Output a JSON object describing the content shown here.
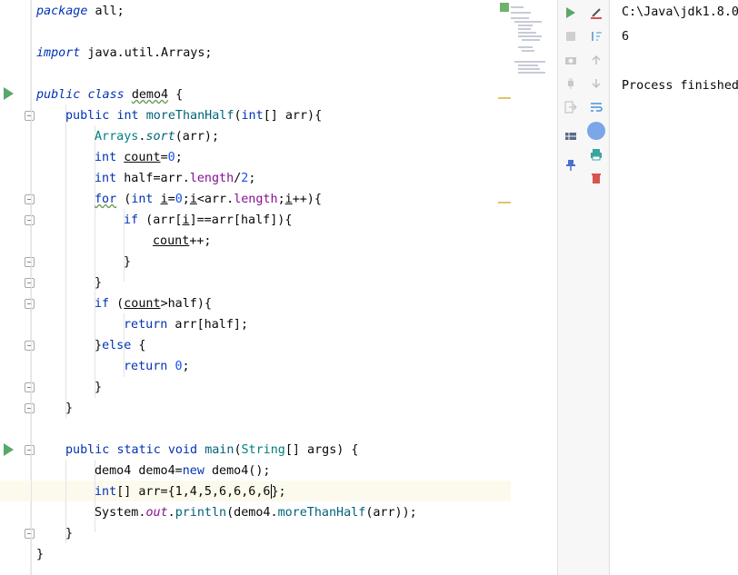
{
  "editor": {
    "lines": {
      "l1": {
        "kw": "package",
        "rest": " all;"
      },
      "l3": {
        "kw": "import",
        "rest": " java.util.Arrays;"
      },
      "l5": {
        "kw1": "public",
        "kw2": "class",
        "name": "demo4",
        "rest": " {"
      },
      "l6": {
        "kw1": "public",
        "type": "int",
        "fn": "moreThanHalf",
        "args_a": "(",
        "type2": "int",
        "args_b": "[] arr){"
      },
      "l7": {
        "cls": "Arrays",
        "dot": ".",
        "fn": "sort",
        "rest": "(arr);"
      },
      "l8": {
        "type": "int",
        "var": "count",
        "eq": "=",
        "num": "0",
        "semi": ";"
      },
      "l9": {
        "type": "int",
        "rest": " half=arr.",
        "fld": "length",
        "op": "/",
        "num": "2",
        "semi": ";"
      },
      "l10": {
        "kw": "for",
        "p1": " (",
        "type": "int",
        "var": "i",
        "eq": "=",
        "num": "0",
        "sc": ";",
        "var2": "i",
        "lt": "<arr.",
        "fld": "length",
        "sc2": ";",
        "var3": "i",
        "inc": "++){"
      },
      "l11": {
        "kw": "if",
        "p1": " (arr[",
        "var": "i",
        "p2": "]==arr[half]){"
      },
      "l12": {
        "var": "count",
        "inc": "++;"
      },
      "l13": {
        "text": "}"
      },
      "l14": {
        "text": "}"
      },
      "l15": {
        "kw": "if",
        "p1": " (",
        "var": "count",
        "rest": ">half){"
      },
      "l16": {
        "kw": "return",
        "rest": " arr[half];"
      },
      "l17": {
        "a": "}",
        "kw": "else",
        "b": " {"
      },
      "l18": {
        "kw": "return",
        "num": "0",
        "semi": ";"
      },
      "l19": {
        "text": "}"
      },
      "l20": {
        "text": "}"
      },
      "l22": {
        "kw1": "public",
        "kw2": "static",
        "kw3": "void",
        "fn": "main",
        "p1": "(",
        "cls": "String",
        "rest": "[] args) {"
      },
      "l23": {
        "a": "demo4 demo4=",
        "kw": "new",
        "b": " demo4();"
      },
      "l24": {
        "type": "int",
        "a": "[] arr=",
        "b": "{1,4,5,6,6,6,6",
        "c": "};"
      },
      "l25": {
        "a": "System.",
        "fld": "out",
        "b": ".",
        "fn": "println",
        "c": "(demo4.",
        "fn2": "moreThanHalf",
        "d": "(arr));"
      },
      "l26": {
        "text": "}"
      },
      "l27": {
        "text": "}"
      }
    }
  },
  "console": {
    "command": "C:\\Java\\jdk1.8.0",
    "output": "6",
    "status": "Process finished"
  },
  "colors": {
    "run_green": "#59a869",
    "keyword": "#0033b3",
    "number": "#1750eb",
    "method": "#00627a",
    "field": "#871094"
  }
}
